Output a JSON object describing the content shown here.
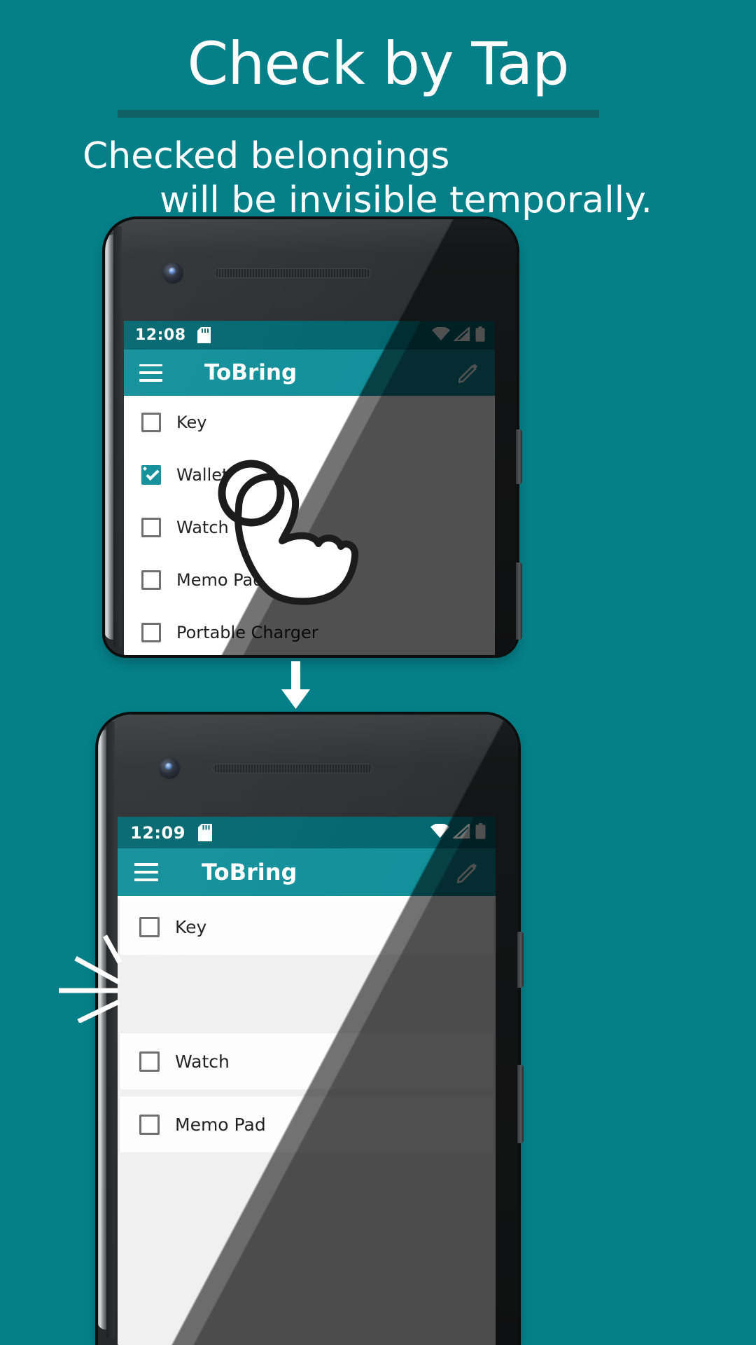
{
  "header": {
    "title": "Check by Tap",
    "subtitle_line1": "Checked belongings",
    "subtitle_line2": "will be invisible temporally."
  },
  "colors": {
    "background": "#058089",
    "rule": "#116068",
    "statusbar": "#00656e",
    "appbar": "#0f8e99",
    "accent": "#0f8e99",
    "checkbox_border": "#6b6b6b",
    "text_dark": "#1c1c1c",
    "card": "#fdfdfd",
    "list_gap": "#f0f0f0"
  },
  "phone_top": {
    "statusbar": {
      "time": "12:08",
      "icons": [
        "sdcard-icon",
        "wifi-icon",
        "signal-icon",
        "battery-icon"
      ]
    },
    "appbar": {
      "menu_icon": "hamburger-menu-icon",
      "title": "ToBring",
      "action_icon": "pencil-edit-icon"
    },
    "items": [
      {
        "label": "Key",
        "checked": false
      },
      {
        "label": "Wallet",
        "checked": true
      },
      {
        "label": "Watch",
        "checked": false
      },
      {
        "label": "Memo Pad",
        "checked": false
      },
      {
        "label": "Portable Charger",
        "checked": false
      }
    ],
    "gesture": "tap-hand-cursor"
  },
  "transition": {
    "arrow_icon": "down-arrow-icon"
  },
  "phone_bottom": {
    "statusbar": {
      "time": "12:09",
      "icons": [
        "sdcard-icon",
        "wifi-icon",
        "signal-icon",
        "battery-icon"
      ]
    },
    "appbar": {
      "menu_icon": "hamburger-menu-icon",
      "title": "ToBring",
      "action_icon": "pencil-edit-icon"
    },
    "items": [
      {
        "label": "Key",
        "checked": false,
        "hidden": false
      },
      {
        "label": "",
        "checked": false,
        "hidden": true
      },
      {
        "label": "Watch",
        "checked": false,
        "hidden": false
      },
      {
        "label": "Memo Pad",
        "checked": false,
        "hidden": false
      }
    ],
    "effect": "sparkle-burst-icon"
  }
}
